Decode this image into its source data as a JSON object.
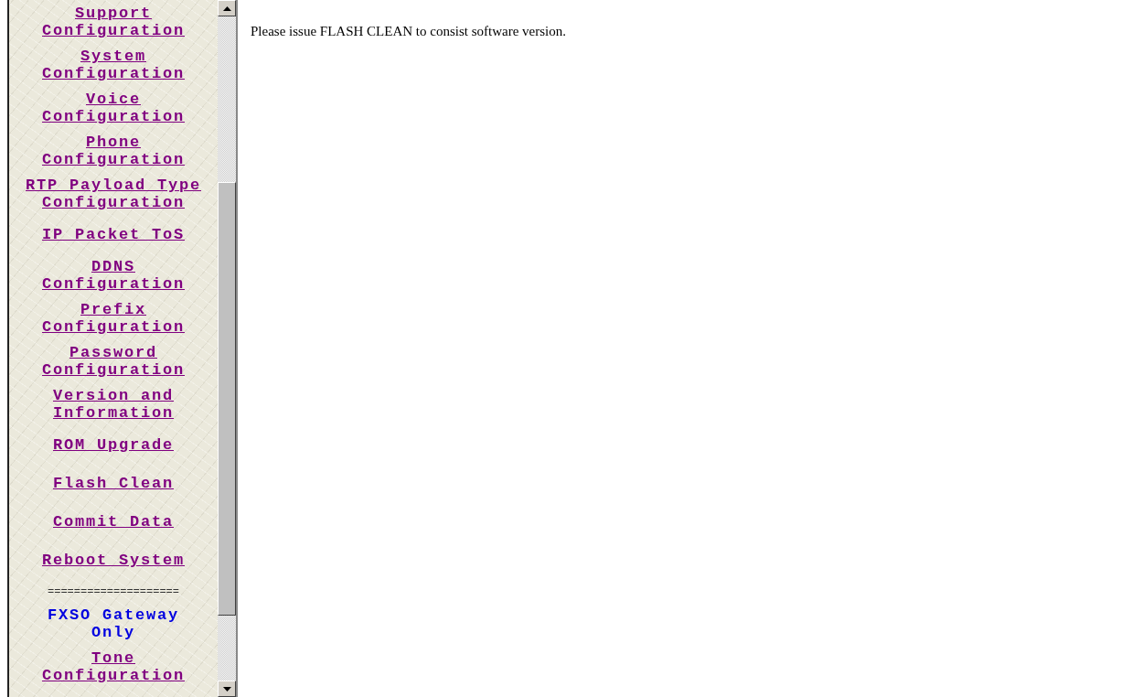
{
  "sidebar": {
    "items": [
      {
        "kind": "link",
        "label": "Support Configuration"
      },
      {
        "kind": "link",
        "label": "System Configuration"
      },
      {
        "kind": "link",
        "label": "Voice Configuration"
      },
      {
        "kind": "link",
        "label": "Phone Configuration"
      },
      {
        "kind": "link",
        "label": "RTP Payload Type Configuration"
      },
      {
        "kind": "link",
        "label": "IP Packet ToS"
      },
      {
        "kind": "link",
        "label": "DDNS Configuration"
      },
      {
        "kind": "link",
        "label": "Prefix Configuration"
      },
      {
        "kind": "link",
        "label": "Password Configuration"
      },
      {
        "kind": "link",
        "label": "Version and Information"
      },
      {
        "kind": "link",
        "label": "ROM Upgrade"
      },
      {
        "kind": "link",
        "label": "Flash Clean"
      },
      {
        "kind": "link",
        "label": "Commit Data"
      },
      {
        "kind": "link",
        "label": "Reboot System"
      },
      {
        "kind": "separator",
        "label": "===================="
      },
      {
        "kind": "heading",
        "label": "FXSO Gateway Only"
      },
      {
        "kind": "link",
        "label": "Tone Configuration"
      }
    ]
  },
  "content": {
    "message": "Please issue FLASH CLEAN to consist software version."
  }
}
